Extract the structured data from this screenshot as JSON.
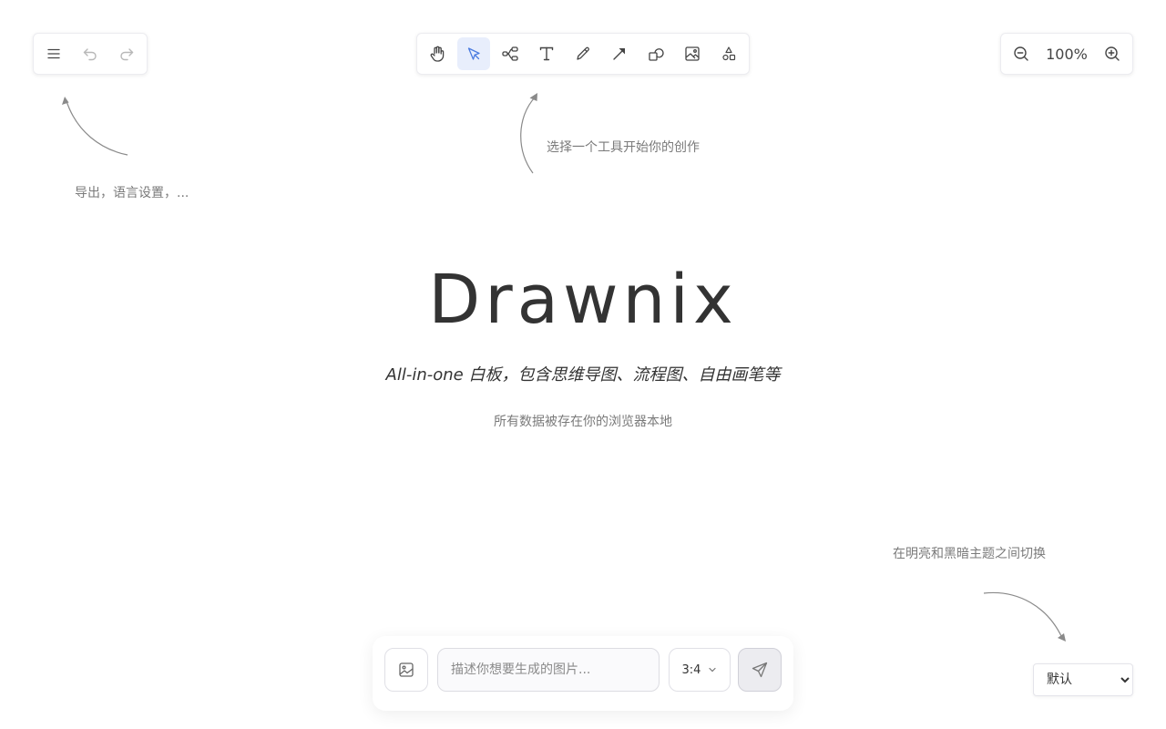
{
  "app_menu": {
    "icons": [
      "menu-icon",
      "undo-icon",
      "redo-icon"
    ]
  },
  "toolbar": {
    "tools": [
      "hand",
      "select",
      "mind-map",
      "text",
      "pen",
      "arrow",
      "shape",
      "image",
      "more-shapes"
    ],
    "active_tool": "select"
  },
  "zoom": {
    "value": "100%"
  },
  "hints": {
    "menu": "导出，语言设置，...",
    "tools": "选择一个工具开始你的创作",
    "theme": "在明亮和黑暗主题之间切换"
  },
  "hero": {
    "title": "Drawnix",
    "subtitle": "All-in-one 白板，包含思维导图、流程图、自由画笔等",
    "note": "所有数据被存在你的浏览器本地"
  },
  "ai_generator": {
    "prompt_placeholder": "描述你想要生成的图片...",
    "prompt_value": "",
    "ratio": "3:4"
  },
  "theme": {
    "selected": "默认",
    "options": [
      "默认"
    ]
  },
  "colors": {
    "accent": "#4a7be0",
    "active_bg": "#e8eefc",
    "text": "#333333",
    "hint": "#7a7a7a"
  }
}
